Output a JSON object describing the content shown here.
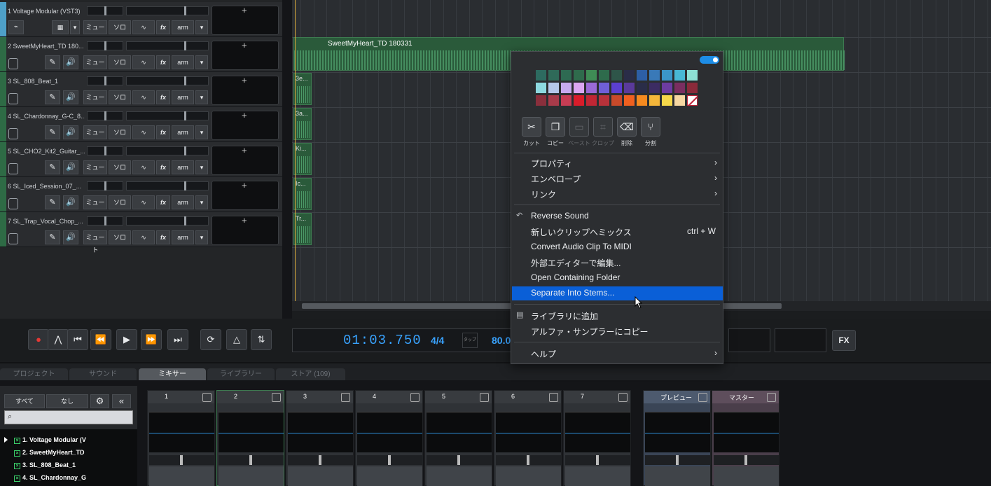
{
  "tracks": [
    {
      "name": "1 Voltage Modular (VST3)"
    },
    {
      "name": "2 SweetMyHeart_TD 180..."
    },
    {
      "name": "3 SL_808_Beat_1"
    },
    {
      "name": "4 SL_Chardonnay_G-C_8..."
    },
    {
      "name": "5 SL_CHO2_Kit2_Guitar_..."
    },
    {
      "name": "6 SL_Iced_Session_07_..."
    },
    {
      "name": "7 SL_Trap_Vocal_Chop_..."
    }
  ],
  "track_buttons": {
    "mute": "ミュート",
    "solo": "ソロ",
    "fx": "fx",
    "arm": "arm",
    "add": "+"
  },
  "clip": {
    "title": "SweetMyHeart_TD 180331"
  },
  "mini_clips": [
    "3e...",
    "3a...",
    "Ki...",
    "Ic...",
    "Tr..."
  ],
  "transport": {
    "time": "01:03.750",
    "signature": "4/4",
    "tap": "タップ",
    "tempo": "80.0",
    "fx": "FX"
  },
  "tabs": [
    {
      "label": "プロジェクト",
      "active": false
    },
    {
      "label": "サウンド",
      "active": false
    },
    {
      "label": "ミキサー",
      "active": true
    },
    {
      "label": "ライブラリー",
      "active": false
    },
    {
      "label": "ストア (109)",
      "active": false
    }
  ],
  "library": {
    "all": "すべて",
    "none": "なし",
    "items": [
      "1. Voltage Modular (V",
      "2. SweetMyHeart_TD",
      "3. SL_808_Beat_1",
      "4. SL_Chardonnay_G"
    ]
  },
  "mixer_channels": [
    "1",
    "2",
    "3",
    "4",
    "5",
    "6",
    "7"
  ],
  "mixer_special": [
    "プレビュー",
    "マスター"
  ],
  "context_menu": {
    "colors": [
      [
        "#2d6b60",
        "#2f6a59",
        "#2e6a52",
        "#2f6b4c",
        "#3f8c55",
        "#2e6b4c",
        "#2e5549",
        "#2a2d48",
        "#2d5fa6",
        "#3979b8",
        "#3b96c8",
        "#48b8d4",
        "#8de0d4"
      ],
      [
        "#8dd9e0",
        "#b5c8ea",
        "#c7aaf0",
        "#dba6f2",
        "#9a6ad8",
        "#6f5fd6",
        "#5b3fd0",
        "#5a3a9a",
        "#2a2d48",
        "#3c2c63",
        "#6d3ca0",
        "#7a2e60",
        "#8a2a3a"
      ],
      [
        "#8a2f3c",
        "#a83b4a",
        "#c73d54",
        "#d91c2a",
        "#c02634",
        "#b8323a",
        "#c94a2a",
        "#f0601f",
        "#f58a1f",
        "#f4b63a",
        "#f6d84a",
        "#f6d7a2",
        "none"
      ]
    ],
    "edit_buttons": [
      {
        "label": "カット",
        "icon": "scissors-icon",
        "enabled": true
      },
      {
        "label": "コピー",
        "icon": "copy-icon",
        "enabled": true
      },
      {
        "label": "ペースト",
        "icon": "paste-icon",
        "enabled": false
      },
      {
        "label": "クロップ",
        "icon": "crop-icon",
        "enabled": false
      },
      {
        "label": "削除",
        "icon": "delete-icon",
        "enabled": true
      },
      {
        "label": "分割",
        "icon": "split-icon",
        "enabled": true
      }
    ],
    "submenus": [
      "プロパティ",
      "エンベロープ",
      "リンク"
    ],
    "items": [
      {
        "label": "Reverse Sound",
        "shortcut": ""
      },
      {
        "label": "新しいクリップへミックス",
        "shortcut": "ctrl + W"
      },
      {
        "label": "Convert Audio Clip To MIDI",
        "shortcut": ""
      },
      {
        "label": "外部エディターで編集...",
        "shortcut": ""
      },
      {
        "label": "Open Containing Folder",
        "shortcut": ""
      },
      {
        "label": "Separate Into Stems...",
        "shortcut": ""
      }
    ],
    "library_items": [
      "ライブラリに追加",
      "アルファ・サンプラーにコピー"
    ],
    "help": "ヘルプ",
    "highlighted": "Separate Into Stems..."
  }
}
